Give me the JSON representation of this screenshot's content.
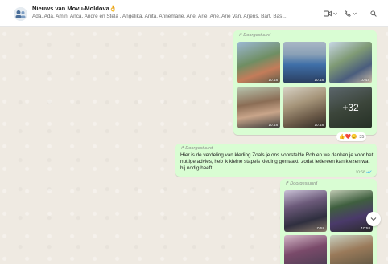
{
  "header": {
    "title": "Nieuws van Movu-Moldova",
    "title_emoji": "👌",
    "members": "Ada, Ada, Amin, Anca, Andre en Stela , Angelika, Anita, Annemarie, Arie, Arie, Arie, Arie Van, Arjens, Bart, Bas,...",
    "video_icon": "video-camera-icon",
    "call_icon": "phone-icon",
    "search_icon": "search-icon"
  },
  "messages": [
    {
      "forwarded": "Doorgestuurd",
      "times": [
        "10:48",
        "10:48",
        "10:48",
        "10:48",
        "10:48"
      ],
      "more_count": "+32"
    },
    {
      "reactions": "👍❤️😊",
      "reaction_count": "35"
    },
    {
      "forwarded": "Doorgestuurd",
      "text": "Hier is de verdeling van kleding.Zoals je ons voorstelde Rob en we danken je voor het nuttige advies, heb ik kleine stapels kleding gemaakt, zodat iedereen kan kiezen wat hij nodig heeft.",
      "time": "10:58"
    },
    {
      "forwarded": "Doorgestuurd",
      "times": [
        "10:58",
        "10:58"
      ]
    }
  ],
  "colors": {
    "bubble": "#d9fdd3",
    "chat_bg": "#efeae2",
    "accent": "#53bdeb"
  }
}
